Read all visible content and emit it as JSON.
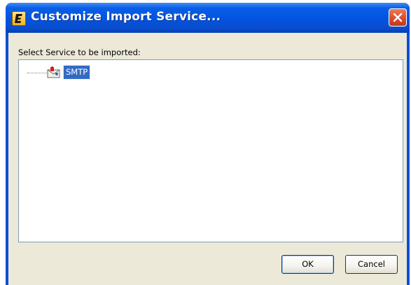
{
  "window": {
    "title": "Customize Import Service...",
    "app_icon": "app-e-icon",
    "close_icon": "close-icon"
  },
  "dialog": {
    "prompt_label": "Select Service to be imported:",
    "tree": {
      "items": [
        {
          "label": "SMTP",
          "icon": "mail-service-icon",
          "selected": true
        }
      ]
    },
    "buttons": {
      "ok_label": "OK",
      "cancel_label": "Cancel"
    }
  },
  "colors": {
    "titlebar": "#0254e0",
    "client_bg": "#ece9d8",
    "selection": "#316ac5",
    "close_button": "#d64a2a"
  }
}
